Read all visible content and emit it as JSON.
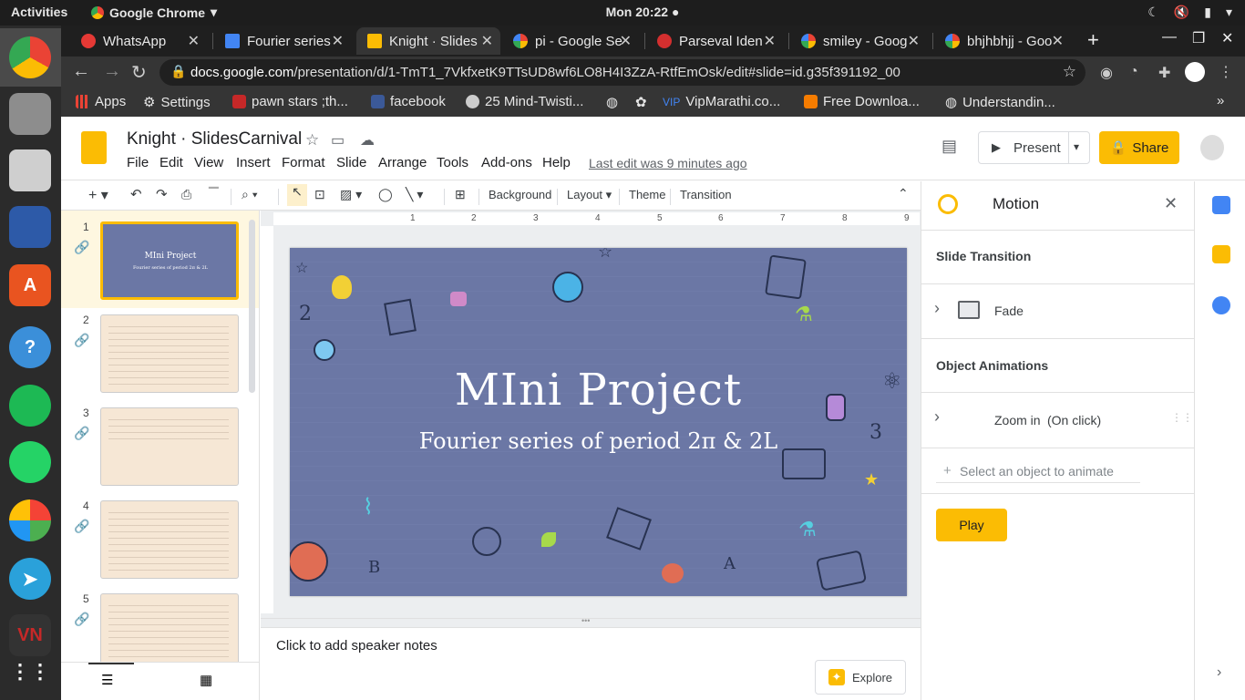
{
  "os": {
    "activities": "Activities",
    "app_name": "Google Chrome",
    "clock": "Mon 20:22 ●"
  },
  "tabs": [
    {
      "label": "WhatsApp",
      "color": "#e53935"
    },
    {
      "label": "Fourier series",
      "color": "#4285f4"
    },
    {
      "label": "Knight · Slides",
      "color": "#fbbc04"
    },
    {
      "label": "pi - Google Se",
      "color": "#ffffff"
    },
    {
      "label": "Parseval Iden",
      "color": "#d32f2f"
    },
    {
      "label": "smiley - Goog",
      "color": "#ffffff"
    },
    {
      "label": "bhjhbhjj - Goo",
      "color": "#ffffff"
    }
  ],
  "url": {
    "domain": "docs.google.com",
    "path": "/presentation/d/1-TmT1_7VkfxetK9TTsUD8wf6LO8H4I3ZzA-RtfEmOsk/edit#slide=id.g35f391192_00"
  },
  "bookmarks": [
    "Apps",
    "Settings",
    "pawn stars ;th...",
    "facebook",
    "25 Mind-Twisti...",
    "VipMarathi.co...",
    "Free Downloa...",
    "Understandin..."
  ],
  "doc": {
    "title": "Knight · SlidesCarnival",
    "menus": [
      "File",
      "Edit",
      "View",
      "Insert",
      "Format",
      "Slide",
      "Arrange",
      "Tools",
      "Add-ons",
      "Help"
    ],
    "last_edit": "Last edit was 9 minutes ago",
    "present": "Present",
    "share": "Share"
  },
  "toolbar": {
    "background": "Background",
    "layout": "Layout",
    "theme": "Theme",
    "transition": "Transition"
  },
  "ruler": [
    "1",
    "2",
    "3",
    "4",
    "5",
    "6",
    "7",
    "8",
    "9"
  ],
  "filmstrip": [
    "1",
    "2",
    "3",
    "4",
    "5"
  ],
  "slide": {
    "title": "MIni Project",
    "subtitle": "Fourier series of period 2π & 2L"
  },
  "notes": {
    "placeholder": "Click to add speaker notes",
    "explore": "Explore"
  },
  "motion": {
    "title": "Motion",
    "slide_transition": "Slide Transition",
    "transition_value": "Fade",
    "object_animations": "Object Animations",
    "animation": "Zoom in",
    "animation_trigger": "(On click)",
    "select_hint": "Select an object to animate",
    "play": "Play"
  }
}
